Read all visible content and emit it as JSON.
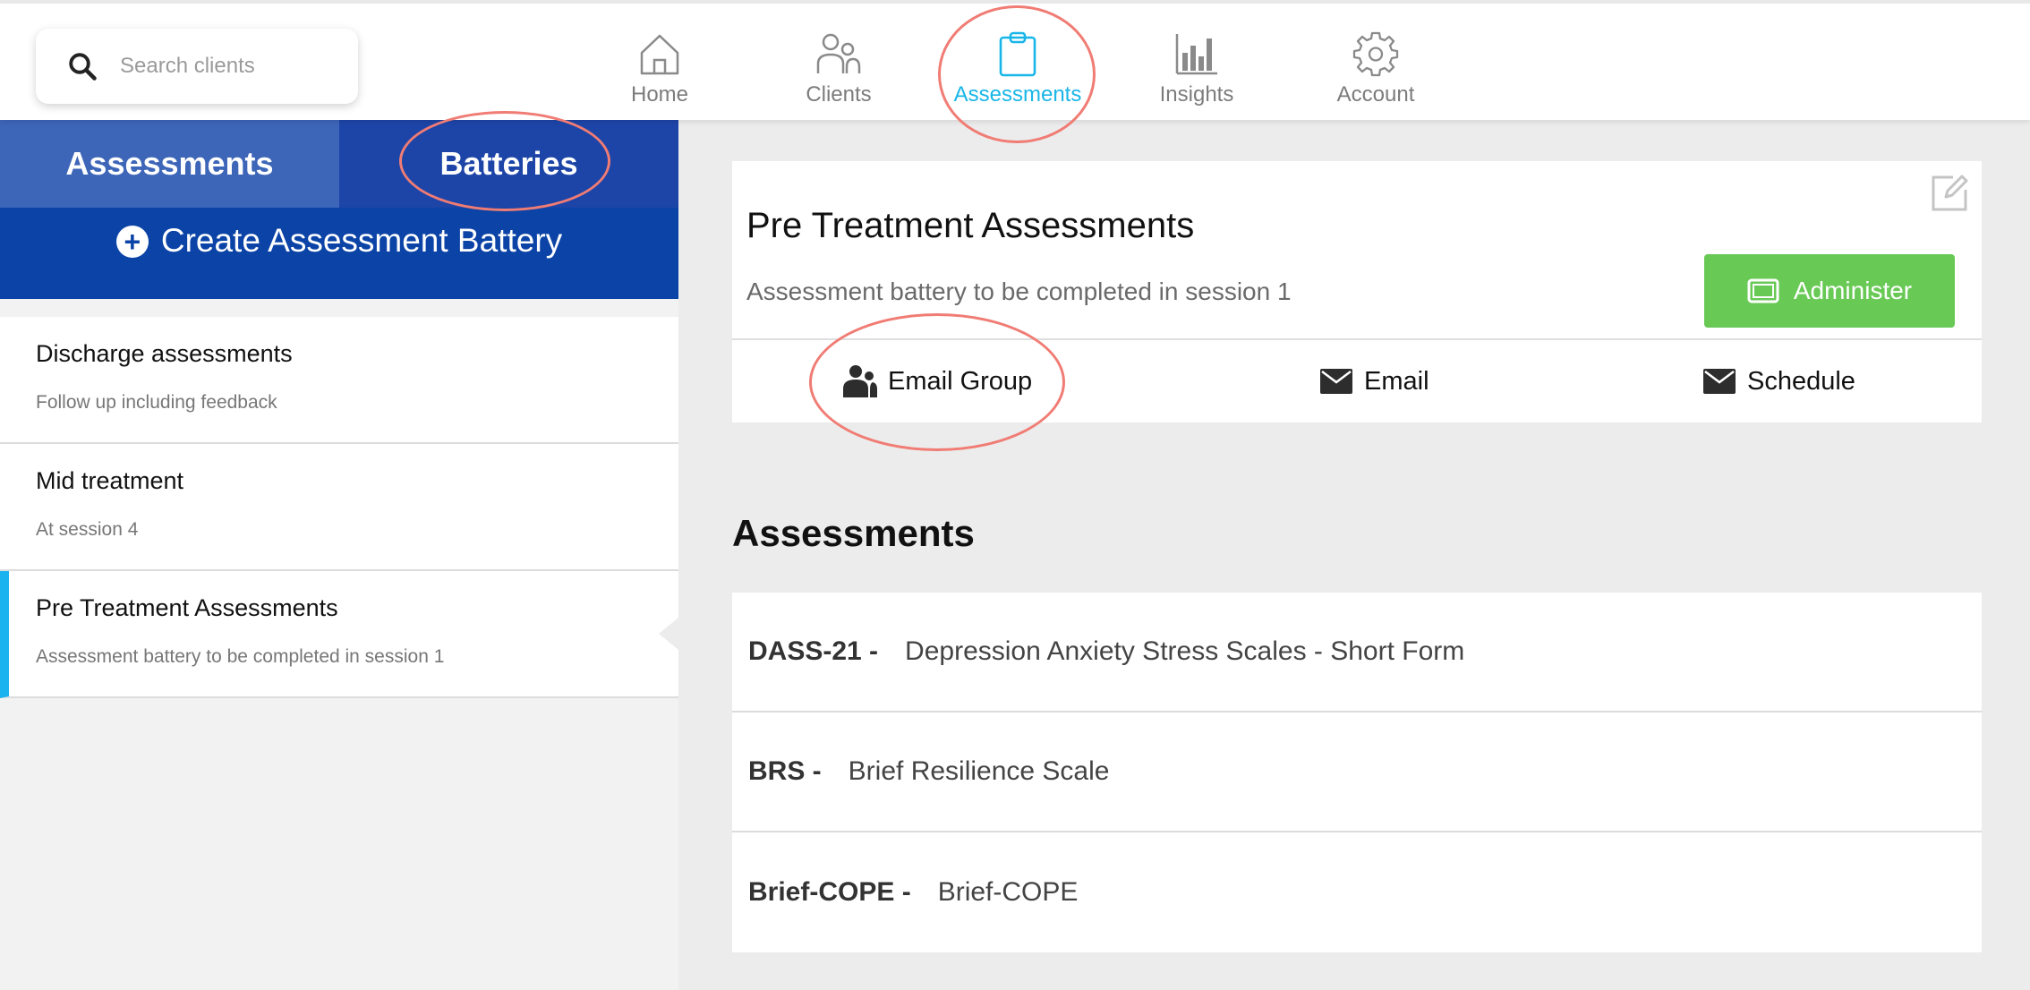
{
  "search": {
    "placeholder": "Search clients"
  },
  "nav": [
    {
      "label": "Home",
      "icon": "home-icon"
    },
    {
      "label": "Clients",
      "icon": "clients-icon"
    },
    {
      "label": "Assessments",
      "icon": "clipboard-icon",
      "active": true
    },
    {
      "label": "Insights",
      "icon": "bar-chart-icon"
    },
    {
      "label": "Account",
      "icon": "gear-icon"
    }
  ],
  "tabs": {
    "assessments": "Assessments",
    "batteries": "Batteries"
  },
  "create_button": "Create Assessment Battery",
  "batteries": [
    {
      "title": "Discharge assessments",
      "subtitle": "Follow up including feedback"
    },
    {
      "title": "Mid treatment",
      "subtitle": "At session 4"
    },
    {
      "title": "Pre Treatment Assessments",
      "subtitle": "Assessment battery to be completed in session 1",
      "selected": true
    }
  ],
  "detail": {
    "title": "Pre Treatment Assessments",
    "description": "Assessment battery to be completed in session 1",
    "administer_label": "Administer",
    "actions": {
      "email_group": "Email Group",
      "email": "Email",
      "schedule": "Schedule"
    }
  },
  "assessments_heading": "Assessments",
  "assessments": [
    {
      "code": "DASS-21 -",
      "name": "Depression Anxiety Stress Scales - Short Form"
    },
    {
      "code": "BRS -",
      "name": "Brief Resilience Scale"
    },
    {
      "code": "Brief-COPE -",
      "name": "Brief-COPE"
    }
  ],
  "colors": {
    "accent": "#18b6e8",
    "primary_blue": "#0b43a6",
    "administer_green": "#68c955",
    "annotation_red": "#f07c74"
  }
}
